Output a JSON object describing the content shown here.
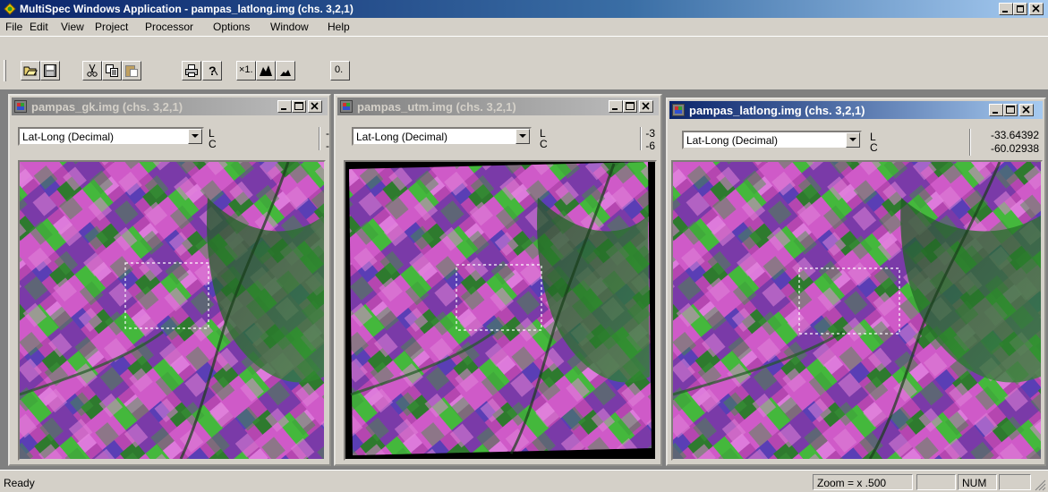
{
  "app": {
    "title": "MultiSpec Windows Application - pampas_latlong.img (chs. 3,2,1)"
  },
  "menu": [
    {
      "label": "File"
    },
    {
      "label": "Edit"
    },
    {
      "label": "View"
    },
    {
      "label": "Project"
    },
    {
      "label": "Processor"
    },
    {
      "label": "Options"
    },
    {
      "label": "Window"
    },
    {
      "label": "Help"
    }
  ],
  "toolbar": {
    "buttons": [
      "open-icon",
      "save-icon",
      "cut-icon",
      "copy-icon",
      "paste-icon",
      "print-icon",
      "help-icon",
      "zoom-x1-icon",
      "zoom-in-icon",
      "zoom-out-icon",
      "overlay-icon"
    ],
    "zoom_x1_label": "×1.",
    "overlay_label": "0."
  },
  "windows": [
    {
      "title": "pampas_gk.img (chs. 3,2,1)",
      "active": false,
      "coord_system": "Lat-Long (Decimal)",
      "line_label": "L",
      "column_label": "C",
      "line_value": "-",
      "column_value": "-"
    },
    {
      "title": "pampas_utm.img (chs. 3,2,1)",
      "active": false,
      "coord_system": "Lat-Long (Decimal)",
      "line_label": "L",
      "column_label": "C",
      "line_value": "-3",
      "column_value": "-6"
    },
    {
      "title": "pampas_latlong.img (chs. 3,2,1)",
      "active": true,
      "coord_system": "Lat-Long (Decimal)",
      "line_label": "L",
      "column_label": "C",
      "line_value": "-33.64392",
      "column_value": "-60.02938"
    }
  ],
  "status": {
    "text": "Ready",
    "zoom": "Zoom = x .500",
    "num": "NUM"
  },
  "colors": {
    "title_active": "#0a246a",
    "title_inactive": "#808080",
    "chrome": "#d4d0c8",
    "mdi_bg": "#808080",
    "image_magenta": "#c64bc0",
    "image_green": "#3fbf3a",
    "image_purple": "#5a3aa8"
  }
}
